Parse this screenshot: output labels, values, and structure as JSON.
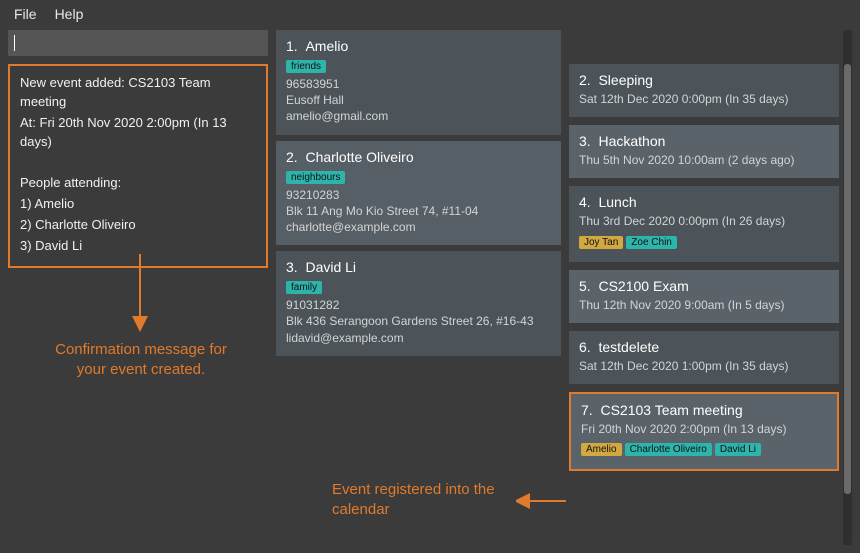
{
  "menu": {
    "file": "File",
    "help": "Help"
  },
  "result": {
    "line1": "New event added: CS2103 Team meeting",
    "line2": "At: Fri 20th Nov 2020 2:00pm (In 13 days)",
    "line3": "",
    "line4": "People attending:",
    "line5": "1) Amelio",
    "line6": "2) Charlotte Oliveiro",
    "line7": "3) David Li"
  },
  "people": [
    {
      "idx": "1.",
      "name": "Amelio",
      "tags": [
        {
          "label": "friends",
          "cls": "teal"
        }
      ],
      "lines": [
        "96583951",
        "Eusoff Hall",
        "amelio@gmail.com"
      ]
    },
    {
      "idx": "2.",
      "name": "Charlotte Oliveiro",
      "tags": [
        {
          "label": "neighbours",
          "cls": "teal"
        }
      ],
      "lines": [
        "93210283",
        "Blk 11 Ang Mo Kio Street 74, #11-04",
        "charlotte@example.com"
      ]
    },
    {
      "idx": "3.",
      "name": "David Li",
      "tags": [
        {
          "label": "family",
          "cls": "teal"
        }
      ],
      "lines": [
        "91031282",
        "Blk 436 Serangoon Gardens Street 26, #16-43",
        "lidavid@example.com"
      ]
    }
  ],
  "events": [
    {
      "idx": "2.",
      "name": "Sleeping",
      "time": "Sat 12th Dec 2020 0:00pm (In 35 days)",
      "tags": []
    },
    {
      "idx": "3.",
      "name": "Hackathon",
      "time": "Thu 5th Nov 2020 10:00am (2 days ago)",
      "tags": []
    },
    {
      "idx": "4.",
      "name": "Lunch",
      "time": "Thu 3rd Dec 2020 0:00pm (In 26 days)",
      "tags": [
        {
          "label": "Joy Tan",
          "cls": "amber"
        },
        {
          "label": "Zoe Chin",
          "cls": "teal"
        }
      ]
    },
    {
      "idx": "5.",
      "name": "CS2100 Exam",
      "time": "Thu 12th Nov 2020 9:00am (In 5 days)",
      "tags": []
    },
    {
      "idx": "6.",
      "name": "testdelete",
      "time": "Sat 12th Dec 2020 1:00pm (In 35 days)",
      "tags": []
    },
    {
      "idx": "7.",
      "name": "CS2103 Team meeting",
      "time": "Fri 20th Nov 2020 2:00pm (In 13 days)",
      "tags": [
        {
          "label": "Amelio",
          "cls": "amber"
        },
        {
          "label": "Charlotte Oliveiro",
          "cls": "teal"
        },
        {
          "label": "David Li",
          "cls": "teal"
        }
      ],
      "highlight": true
    }
  ],
  "annotations": {
    "a1": "Confirmation message for your event created.",
    "a2": "Event registered into the calendar"
  }
}
